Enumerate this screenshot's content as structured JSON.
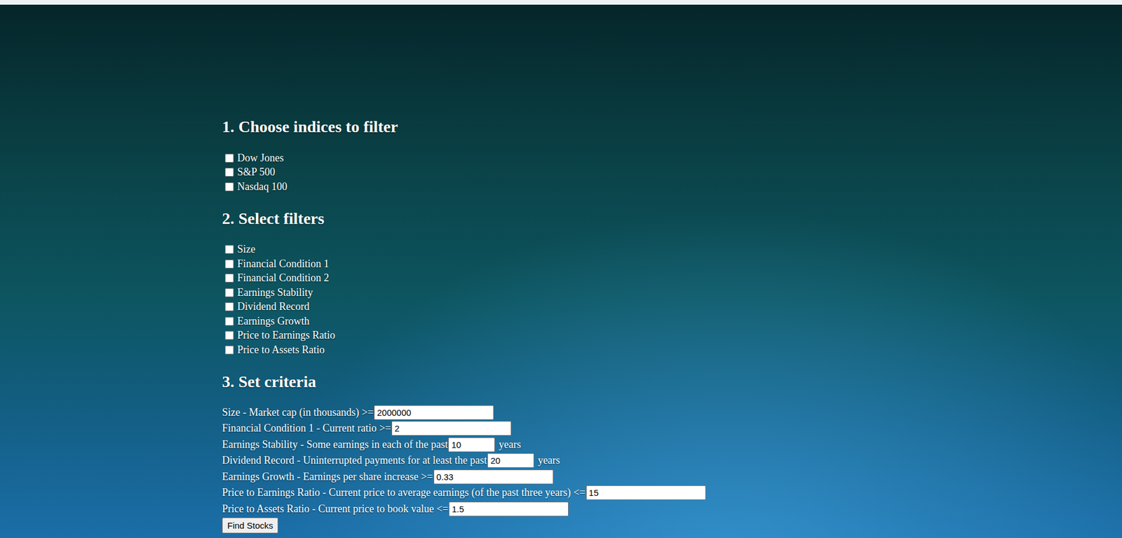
{
  "indices": {
    "title": "1. Choose indices to filter",
    "items": [
      {
        "label": "Dow Jones",
        "checked": false
      },
      {
        "label": "S&P 500",
        "checked": false
      },
      {
        "label": "Nasdaq 100",
        "checked": false
      }
    ]
  },
  "filters": {
    "title": "2. Select filters",
    "items": [
      {
        "label": "Size",
        "checked": false
      },
      {
        "label": "Financial Condition 1",
        "checked": false
      },
      {
        "label": "Financial Condition 2",
        "checked": false
      },
      {
        "label": "Earnings Stability",
        "checked": false
      },
      {
        "label": "Dividend Record",
        "checked": false
      },
      {
        "label": "Earnings Growth",
        "checked": false
      },
      {
        "label": "Price to Earnings Ratio",
        "checked": false
      },
      {
        "label": "Price to Assets Ratio",
        "checked": false
      }
    ]
  },
  "criteria": {
    "title": "3. Set criteria",
    "rows": [
      {
        "label": "Size - Market cap (in thousands) >=",
        "value": "2000000",
        "narrow": false
      },
      {
        "label": "Financial Condition 1 - Current ratio >=",
        "value": "2",
        "narrow": false
      },
      {
        "label": "Earnings Stability - Some earnings in each of the past",
        "value": "10",
        "narrow": true,
        "suffix": "years"
      },
      {
        "label": "Dividend Record - Uninterrupted payments for at least the past",
        "value": "20",
        "narrow": true,
        "suffix": "years"
      },
      {
        "label": "Earnings Growth - Earnings per share increase >=",
        "value": "0.33",
        "narrow": false
      },
      {
        "label": "Price to Earnings Ratio - Current price to average earnings (of the past three years) <=",
        "value": "15",
        "narrow": false
      },
      {
        "label": "Price to Assets Ratio - Current price to book value <=",
        "value": "1.5",
        "narrow": false
      }
    ]
  },
  "button": "Find Stocks"
}
